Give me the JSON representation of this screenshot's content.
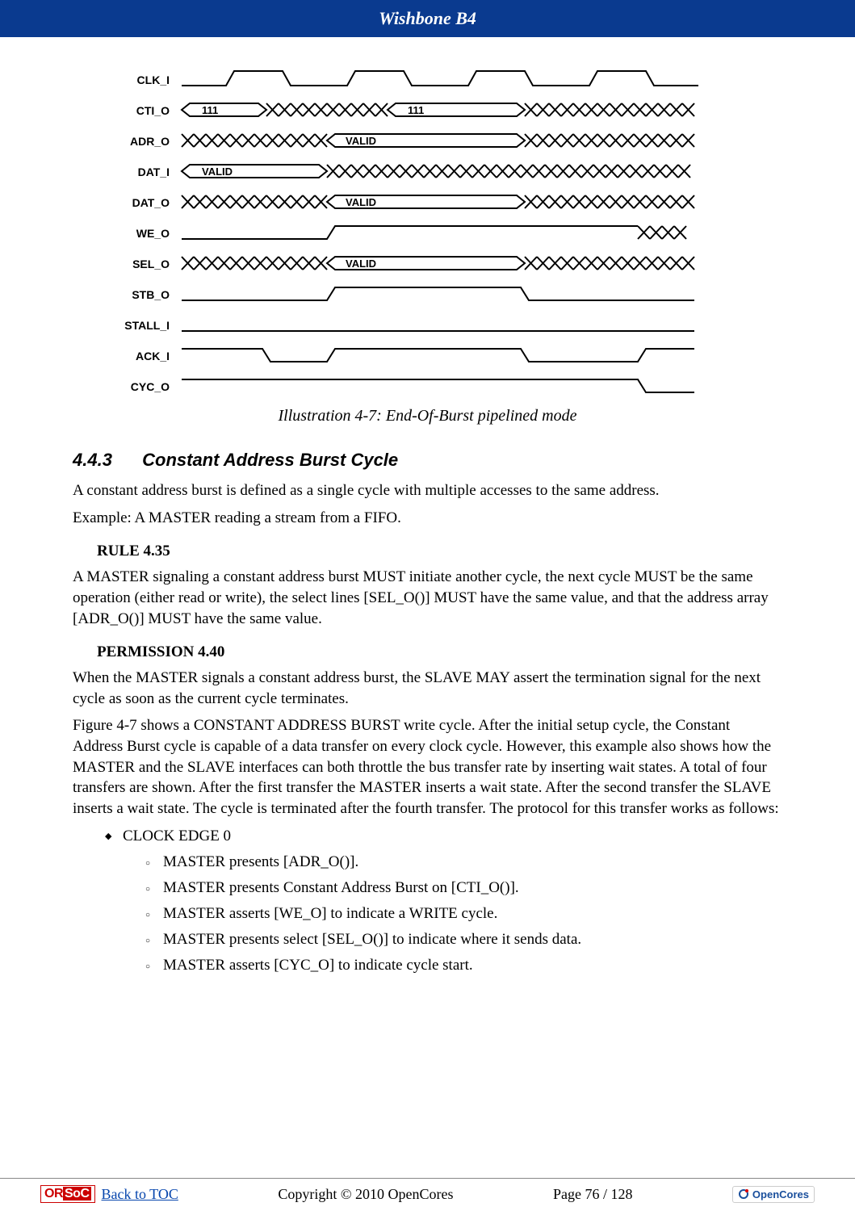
{
  "header": {
    "title": "Wishbone B4"
  },
  "diagram": {
    "signals": [
      "CLK_I",
      "CTI_O",
      "ADR_O",
      "DAT_I",
      "DAT_O",
      "WE_O",
      "SEL_O",
      "STB_O",
      "STALL_I",
      "ACK_I",
      "CYC_O"
    ],
    "values": {
      "cti_1": "111",
      "cti_2": "111",
      "adr": "VALID",
      "dat_i": "VALID",
      "dat_o": "VALID",
      "sel": "VALID"
    },
    "caption": "Illustration 4-7: End-Of-Burst pipelined mode"
  },
  "section": {
    "number": "4.4.3",
    "title": "Constant Address Burst Cycle",
    "p1": "A constant address burst is defined as a single cycle with multiple accesses to the same address.",
    "p2": "Example: A MASTER reading a stream from a FIFO.",
    "rule_head": "RULE 4.35",
    "rule_body": "A MASTER signaling a constant address burst MUST initiate another cycle, the next cycle MUST be the same operation (either read or write), the select lines [SEL_O()] MUST have the same value, and that the address array [ADR_O()] MUST have the same value.",
    "perm_head": "PERMISSION 4.40",
    "perm_body": "When the MASTER signals a constant address burst, the SLAVE MAY assert the termination signal for the next cycle as soon as the current cycle terminates.",
    "p3": "Figure 4-7 shows a CONSTANT ADDRESS BURST write cycle. After the initial setup cycle, the Constant Address Burst cycle is capable of a data transfer on every clock cycle. However, this example also shows how the MASTER and the SLAVE interfaces can both throttle the bus transfer rate by inserting wait states. A total of four transfers are shown. After the first transfer the MASTER inserts a wait state. After the second transfer the SLAVE inserts a wait state. The cycle is terminated after the fourth transfer. The protocol for this transfer works as follows:",
    "bullet": "CLOCK EDGE 0",
    "sub": [
      "MASTER presents [ADR_O()].",
      "MASTER presents Constant Address Burst on [CTI_O()].",
      "MASTER asserts [WE_O] to indicate a WRITE cycle.",
      "MASTER presents select [SEL_O()] to indicate where it sends data.",
      "MASTER asserts [CYC_O] to indicate cycle start."
    ]
  },
  "footer": {
    "toc": "Back to TOC",
    "copyright": "Copyright © 2010 OpenCores",
    "page": "Page 76 / 128",
    "orsoc_or": "OR",
    "orsoc_soc": "SoC",
    "opencores": "OpenCores"
  }
}
